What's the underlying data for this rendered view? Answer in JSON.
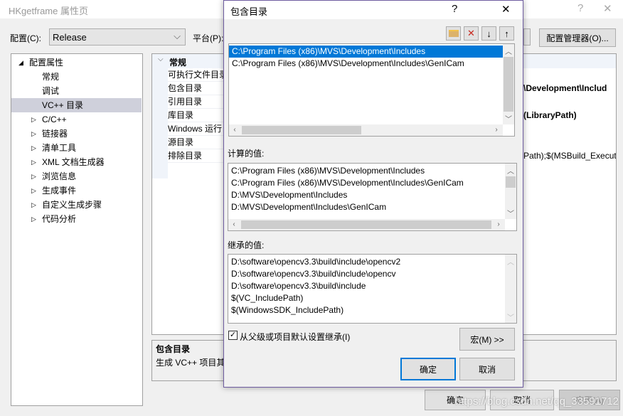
{
  "window": {
    "title": "HKgetframe 属性页",
    "help": "?",
    "close": "✕"
  },
  "config": {
    "label": "配置(C):",
    "value": "Release",
    "platform_label": "平台(P):",
    "manager_button": "配置管理器(O)..."
  },
  "tree": {
    "root": "配置属性",
    "items": [
      {
        "label": "常规",
        "expandable": false
      },
      {
        "label": "调试",
        "expandable": false
      },
      {
        "label": "VC++ 目录",
        "expandable": false,
        "selected": true
      },
      {
        "label": "C/C++",
        "expandable": true
      },
      {
        "label": "链接器",
        "expandable": true
      },
      {
        "label": "清单工具",
        "expandable": true
      },
      {
        "label": "XML 文档生成器",
        "expandable": true
      },
      {
        "label": "浏览信息",
        "expandable": true
      },
      {
        "label": "生成事件",
        "expandable": true
      },
      {
        "label": "自定义生成步骤",
        "expandable": true
      },
      {
        "label": "代码分析",
        "expandable": true
      }
    ]
  },
  "grid": {
    "section": "常规",
    "rows": [
      {
        "name": "可执行文件目录",
        "value": ""
      },
      {
        "name": "包含目录",
        "value": "\\Development\\Includ"
      },
      {
        "name": "引用目录",
        "value": ""
      },
      {
        "name": "库目录",
        "value": "(LibraryPath)"
      },
      {
        "name": "Windows 运行",
        "value": ""
      },
      {
        "name": "源目录",
        "value": ""
      },
      {
        "name": "排除目录",
        "value": "Path);$(MSBuild_Executa"
      }
    ]
  },
  "description": {
    "title": "包含目录",
    "text": "生成 VC++ 项目其"
  },
  "bottom": {
    "ok": "确定",
    "cancel": "取消",
    "apply": "应用(A)"
  },
  "dialog": {
    "title": "包含目录",
    "help": "?",
    "close": "✕",
    "toolbar": [
      "new-folder-icon",
      "delete-icon",
      "move-down-icon",
      "move-up-icon"
    ],
    "entries": [
      "C:\\Program Files (x86)\\MVS\\Development\\Includes",
      "C:\\Program Files (x86)\\MVS\\Development\\Includes\\GenICam"
    ],
    "computed_label": "计算的值:",
    "computed": [
      "C:\\Program Files (x86)\\MVS\\Development\\Includes",
      "C:\\Program Files (x86)\\MVS\\Development\\Includes\\GenICam",
      "D:\\MVS\\Development\\Includes",
      "D:\\MVS\\Development\\Includes\\GenICam"
    ],
    "inherited_label": "继承的值:",
    "inherited": [
      "D:\\software\\opencv3.3\\build\\include\\opencv2",
      "D:\\software\\opencv3.3\\build\\include\\opencv",
      "D:\\software\\opencv3.3\\build\\include",
      "$(VC_IncludePath)",
      "$(WindowsSDK_IncludePath)"
    ],
    "inherit_checkbox": {
      "label": "从父级或项目默认设置继承(I)",
      "checked": true
    },
    "macro_button": "宏(M) >>",
    "ok": "确定",
    "cancel": "取消"
  },
  "watermark": "https://blog.csdn.net/qq_33591712",
  "colors": {
    "selection": "#0078d7",
    "tree_selection": "#cfd0db",
    "dialog_border": "#6e5ca0"
  }
}
